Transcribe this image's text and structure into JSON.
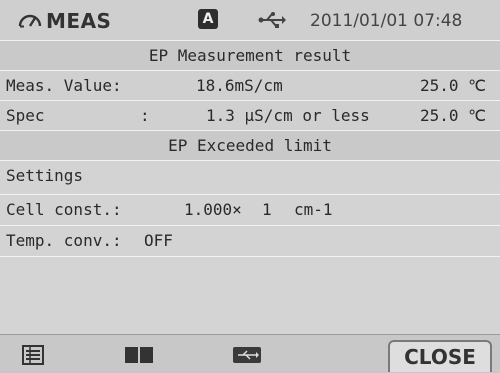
{
  "status_bar": {
    "mode_label": "MEAS",
    "auto_badge": "A",
    "datetime": "2011/01/01 07:48"
  },
  "screen_title": "EP Measurement result",
  "measurement": {
    "label": "Meas. Value:",
    "value": "18.6mS/cm",
    "temp": "25.0 ℃"
  },
  "spec": {
    "label": "Spec",
    "colon": ":",
    "value": "1.3 μS/cm or less",
    "temp": "25.0 ℃"
  },
  "alert": "EP Exceeded limit",
  "settings": {
    "heading": "Settings",
    "cell_const_label": "Cell const.:",
    "cell_const_value": "1.000×",
    "cell_const_factor": "1",
    "cell_const_unit": "cm-1",
    "temp_conv_label": "Temp. conv.:",
    "temp_conv_value": "OFF"
  },
  "toolbar": {
    "close_label": "CLOSE",
    "icons": [
      "list-icon",
      "book-icon",
      "usb-connect-icon"
    ]
  }
}
